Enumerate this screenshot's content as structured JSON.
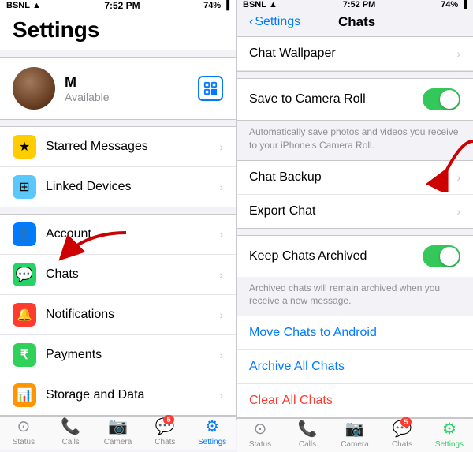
{
  "left": {
    "statusBar": {
      "carrier": "BSNL",
      "wifi": "wifi",
      "time": "7:52 PM",
      "location": "▲",
      "signal": "74%",
      "battery": "🔋"
    },
    "title": "Settings",
    "profile": {
      "name": "M",
      "status": "Available",
      "qrLabel": "QR"
    },
    "menuItems": [
      {
        "id": "starred",
        "label": "Starred Messages",
        "iconType": "star",
        "iconChar": "★"
      },
      {
        "id": "linked",
        "label": "Linked Devices",
        "iconType": "devices",
        "iconChar": "⊞"
      },
      {
        "id": "account",
        "label": "Account",
        "iconType": "account",
        "iconChar": "👤"
      },
      {
        "id": "chats",
        "label": "Chats",
        "iconType": "chats",
        "iconChar": "💬"
      },
      {
        "id": "notifications",
        "label": "Notifications",
        "iconType": "notif",
        "iconChar": "🔔"
      },
      {
        "id": "payments",
        "label": "Payments",
        "iconType": "payments",
        "iconChar": "₹"
      },
      {
        "id": "storage",
        "label": "Storage and Data",
        "iconType": "storage",
        "iconChar": "📊"
      }
    ],
    "tabBar": {
      "items": [
        {
          "id": "status",
          "label": "Status",
          "icon": "●",
          "active": false
        },
        {
          "id": "calls",
          "label": "Calls",
          "icon": "📞",
          "active": false
        },
        {
          "id": "camera",
          "label": "Camera",
          "icon": "📷",
          "active": false
        },
        {
          "id": "chats",
          "label": "Chats",
          "icon": "💬",
          "active": false,
          "badge": "5"
        },
        {
          "id": "settings",
          "label": "Settings",
          "icon": "⚙",
          "active": true
        }
      ]
    }
  },
  "right": {
    "statusBar": {
      "carrier": "BSNL",
      "wifi": "wifi",
      "time": "7:52 PM",
      "signal": "74%",
      "battery": "🔋"
    },
    "nav": {
      "backLabel": "Settings",
      "title": "Chats"
    },
    "sections": [
      {
        "items": [
          {
            "id": "wallpaper",
            "label": "Chat Wallpaper",
            "type": "nav"
          },
          {
            "id": "cameraRoll",
            "label": "Save to Camera Roll",
            "type": "toggle",
            "value": true
          },
          {
            "id": "cameraRollDesc",
            "type": "description",
            "text": "Automatically save photos and videos you receive to your iPhone's Camera Roll."
          },
          {
            "id": "backup",
            "label": "Chat Backup",
            "type": "nav"
          },
          {
            "id": "export",
            "label": "Export Chat",
            "type": "nav"
          }
        ]
      },
      {
        "items": [
          {
            "id": "keepArchived",
            "label": "Keep Chats Archived",
            "type": "toggle",
            "value": true
          },
          {
            "id": "keepArchivedDesc",
            "type": "description",
            "text": "Archived chats will remain archived when you receive a new message."
          }
        ]
      },
      {
        "items": [
          {
            "id": "moveAndroid",
            "label": "Move Chats to Android",
            "type": "link"
          },
          {
            "id": "archiveAll",
            "label": "Archive All Chats",
            "type": "link"
          },
          {
            "id": "clearAll",
            "label": "Clear All Chats",
            "type": "link-red"
          }
        ]
      }
    ],
    "tabBar": {
      "items": [
        {
          "id": "status",
          "label": "Status",
          "icon": "●",
          "active": false
        },
        {
          "id": "calls",
          "label": "Calls",
          "icon": "📞",
          "active": false
        },
        {
          "id": "camera",
          "label": "Camera",
          "icon": "📷",
          "active": false
        },
        {
          "id": "chats",
          "label": "Chats",
          "icon": "💬",
          "active": false,
          "badge": "5"
        },
        {
          "id": "settings",
          "label": "Settings",
          "icon": "⚙",
          "active": true
        }
      ]
    }
  }
}
